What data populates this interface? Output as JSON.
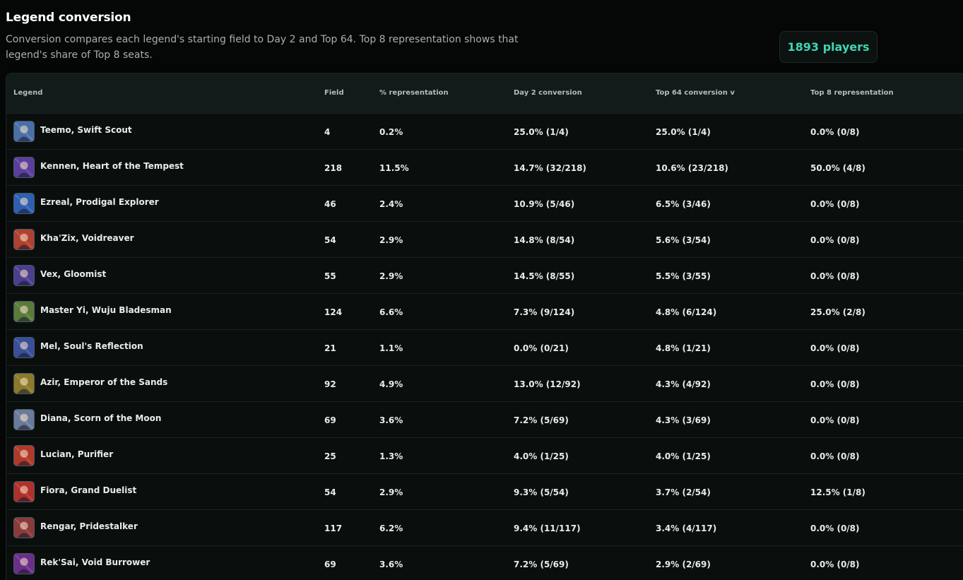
{
  "header": {
    "title": "Legend conversion",
    "subtitle": "Conversion compares each legend's starting field to Day 2 and Top 64. Top 8 representation shows that legend's share of Top 8 seats.",
    "players": "1893 players"
  },
  "table": {
    "columns": {
      "legend": "Legend",
      "field": "Field",
      "pct": "% representation",
      "day2": "Day 2 conversion",
      "top64": "Top 64 conversion v",
      "top8": "Top 8 representation"
    },
    "rows": [
      {
        "name": "Teemo, Swift Scout",
        "field": "4",
        "pct": "0.2%",
        "day2": "25.0% (1/4)",
        "top64": "25.0% (1/4)",
        "top8": "0.0% (0/8)",
        "avatar_color": "#4a6fa8"
      },
      {
        "name": "Kennen, Heart of the Tempest",
        "field": "218",
        "pct": "11.5%",
        "day2": "14.7% (32/218)",
        "top64": "10.6% (23/218)",
        "top8": "50.0% (4/8)",
        "avatar_color": "#5a3f9c"
      },
      {
        "name": "Ezreal, Prodigal Explorer",
        "field": "46",
        "pct": "2.4%",
        "day2": "10.9% (5/46)",
        "top64": "6.5% (3/46)",
        "top8": "0.0% (0/8)",
        "avatar_color": "#2f5fb0"
      },
      {
        "name": "Kha'Zix, Voidreaver",
        "field": "54",
        "pct": "2.9%",
        "day2": "14.8% (8/54)",
        "top64": "5.6% (3/54)",
        "top8": "0.0% (0/8)",
        "avatar_color": "#b0402f"
      },
      {
        "name": "Vex, Gloomist",
        "field": "55",
        "pct": "2.9%",
        "day2": "14.5% (8/55)",
        "top64": "5.5% (3/55)",
        "top8": "0.0% (0/8)",
        "avatar_color": "#4a3f8f"
      },
      {
        "name": "Master Yi, Wuju Bladesman",
        "field": "124",
        "pct": "6.6%",
        "day2": "7.3% (9/124)",
        "top64": "4.8% (6/124)",
        "top8": "25.0% (2/8)",
        "avatar_color": "#5a7a3a"
      },
      {
        "name": "Mel, Soul's Reflection",
        "field": "21",
        "pct": "1.1%",
        "day2": "0.0% (0/21)",
        "top64": "4.8% (1/21)",
        "top8": "0.0% (0/8)",
        "avatar_color": "#3a4f9a"
      },
      {
        "name": "Azir, Emperor of the Sands",
        "field": "92",
        "pct": "4.9%",
        "day2": "13.0% (12/92)",
        "top64": "4.3% (4/92)",
        "top8": "0.0% (0/8)",
        "avatar_color": "#8a7a2a"
      },
      {
        "name": "Diana, Scorn of the Moon",
        "field": "69",
        "pct": "3.6%",
        "day2": "7.2% (5/69)",
        "top64": "4.3% (3/69)",
        "top8": "0.0% (0/8)",
        "avatar_color": "#6a7a9a"
      },
      {
        "name": "Lucian, Purifier",
        "field": "25",
        "pct": "1.3%",
        "day2": "4.0% (1/25)",
        "top64": "4.0% (1/25)",
        "top8": "0.0% (0/8)",
        "avatar_color": "#b03a2a"
      },
      {
        "name": "Fiora, Grand Duelist",
        "field": "54",
        "pct": "2.9%",
        "day2": "9.3% (5/54)",
        "top64": "3.7% (2/54)",
        "top8": "12.5% (1/8)",
        "avatar_color": "#b0302a"
      },
      {
        "name": "Rengar, Pridestalker",
        "field": "117",
        "pct": "6.2%",
        "day2": "9.4% (11/117)",
        "top64": "3.4% (4/117)",
        "top8": "0.0% (0/8)",
        "avatar_color": "#8a3a3a"
      },
      {
        "name": "Rek'Sai, Void Burrower",
        "field": "69",
        "pct": "3.6%",
        "day2": "7.2% (5/69)",
        "top64": "2.9% (2/69)",
        "top8": "0.0% (0/8)",
        "avatar_color": "#6a2f8a"
      }
    ]
  }
}
